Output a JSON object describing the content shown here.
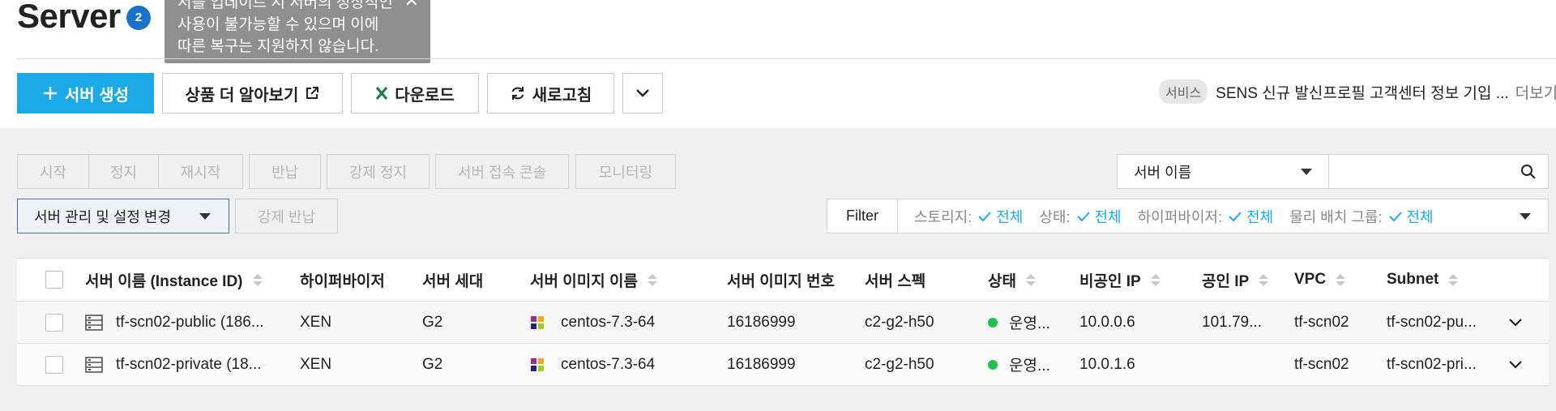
{
  "header": {
    "title": "Server",
    "badge_count": "2",
    "tooltip_lines": [
      "서를 업데이트 시 서버의 정상적인",
      "사용이 불가능할 수 있으며 이에",
      "따른 복구는 지원하지 않습니다."
    ],
    "tooltip_close": "✕"
  },
  "toolbar": {
    "create": "서버 생성",
    "learn_more": "상품 더 알아보기",
    "download": "다운로드",
    "refresh": "새로고침"
  },
  "service_notice": {
    "tag": "서비스",
    "text": "SENS 신규 발신프로필 고객센터 정보 기입 ...",
    "more": "더보기"
  },
  "actions": {
    "start": "시작",
    "stop": "정지",
    "restart": "재시작",
    "return": "반납",
    "force_stop": "강제 정지",
    "console": "서버 접속 콘솔",
    "monitoring": "모니터링",
    "manage_settings": "서버 관리 및 설정 변경",
    "force_return": "강제 반납"
  },
  "search": {
    "field": "서버 이름"
  },
  "filter": {
    "label": "Filter",
    "storage_label": "스토리지:",
    "storage_value": "전체",
    "state_label": "상태:",
    "state_value": "전체",
    "hypervisor_label": "하이퍼바이저:",
    "hypervisor_value": "전체",
    "placement_label": "물리 배치 그룹:",
    "placement_value": "전체"
  },
  "table": {
    "columns": [
      "서버 이름 (Instance ID)",
      "하이퍼바이저",
      "서버 세대",
      "서버 이미지 이름",
      "서버 이미지 번호",
      "서버 스펙",
      "상태",
      "비공인 IP",
      "공인 IP",
      "VPC",
      "Subnet"
    ],
    "rows": [
      {
        "name": "tf-scn02-public (186...",
        "hypervisor": "XEN",
        "generation": "G2",
        "image_name": "centos-7.3-64",
        "image_no": "16186999",
        "spec": "c2-g2-h50",
        "status": "운영...",
        "private_ip": "10.0.0.6",
        "public_ip": "101.79...",
        "vpc": "tf-scn02",
        "subnet": "tf-scn02-pu..."
      },
      {
        "name": "tf-scn02-private (18...",
        "hypervisor": "XEN",
        "generation": "G2",
        "image_name": "centos-7.3-64",
        "image_no": "16186999",
        "spec": "c2-g2-h50",
        "status": "운영...",
        "private_ip": "10.0.1.6",
        "public_ip": "",
        "vpc": "tf-scn02",
        "subnet": "tf-scn02-pri..."
      }
    ]
  },
  "colors": {
    "primary": "#1ba9e8",
    "badge": "#1a73c8",
    "status_running": "#21c14a",
    "excel_green": "#1d7a43"
  },
  "icons": [
    "plus-icon",
    "external-link-icon",
    "excel-icon",
    "refresh-icon",
    "chevron-down-icon",
    "search-icon",
    "check-icon",
    "server-icon",
    "centos-icon",
    "sort-icon"
  ]
}
